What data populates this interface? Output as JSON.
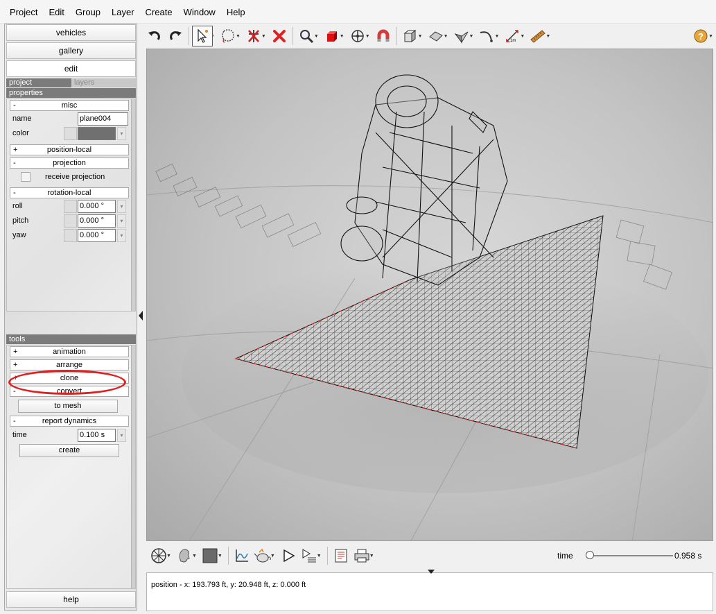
{
  "menu": [
    "Project",
    "Edit",
    "Group",
    "Layer",
    "Create",
    "Window",
    "Help"
  ],
  "left": {
    "nav": [
      "vehicles",
      "gallery",
      "edit"
    ],
    "tabs": [
      "project",
      "layers"
    ],
    "properties_header": "properties",
    "misc": {
      "sign": "-",
      "title": "misc"
    },
    "name_label": "name",
    "name_value": "plane004",
    "color_label": "color",
    "color_value": "#707070",
    "position_local": {
      "sign": "+",
      "title": "position-local"
    },
    "projection": {
      "sign": "-",
      "title": "projection"
    },
    "receive_projection": "receive projection",
    "rotation_local": {
      "sign": "-",
      "title": "rotation-local"
    },
    "roll_label": "roll",
    "roll_value": "0.000 °",
    "pitch_label": "pitch",
    "pitch_value": "0.000 °",
    "yaw_label": "yaw",
    "yaw_value": "0.000 °",
    "tools_header": "tools",
    "animation": {
      "sign": "+",
      "title": "animation"
    },
    "arrange": {
      "sign": "+",
      "title": "arrange"
    },
    "clone": {
      "sign": "+",
      "title": "clone"
    },
    "convert": {
      "sign": "-",
      "title": "convert"
    },
    "to_mesh": "to mesh",
    "report_dynamics": {
      "sign": "-",
      "title": "report dynamics"
    },
    "time_label": "time",
    "time_value": "0.100 s",
    "create": "create",
    "help": "help",
    "highlight_color": "#e02020"
  },
  "toolbar_icons": [
    "undo-icon",
    "redo-icon",
    "select-arrow-icon",
    "lasso-icon",
    "no-move-icon",
    "delete-x-icon",
    "zoom-icon",
    "red-cube-icon",
    "move-cross-icon",
    "magnet-icon",
    "box-icon",
    "plane-icon",
    "folded-plane-icon",
    "curve-icon",
    "measure-icon",
    "ruler-icon",
    "help-icon"
  ],
  "bottom": {
    "time_label": "time",
    "time_value": "0.958 s",
    "time_fraction": 0.05
  },
  "status": {
    "position": "position - x: 193.793 ft, y: 20.948 ft, z: 0.000 ft"
  }
}
